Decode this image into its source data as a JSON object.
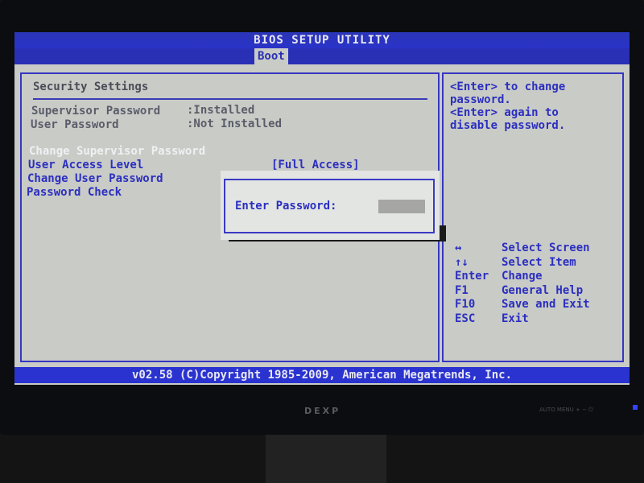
{
  "header": {
    "title": "BIOS SETUP UTILITY",
    "active_tab": "Boot"
  },
  "left_panel": {
    "title": "Security Settings",
    "status": [
      {
        "label": "Supervisor Password",
        "value": ":Installed"
      },
      {
        "label": "User Password",
        "value": ":Not Installed"
      }
    ],
    "items": [
      {
        "label": "Change Supervisor Password",
        "value": ""
      },
      {
        "label": "User Access Level",
        "value": "[Full Access]"
      },
      {
        "label": "Change User Password",
        "value": ""
      },
      {
        "label": "Password Check",
        "value": ""
      }
    ]
  },
  "dialog": {
    "label": "Enter Password:",
    "value": ""
  },
  "help": {
    "lines": [
      "<Enter> to change",
      "password.",
      "<Enter> again to",
      "disable password."
    ],
    "keys": [
      {
        "key": "↔",
        "action": "Select Screen"
      },
      {
        "key": "↑↓",
        "action": "Select Item"
      },
      {
        "key": "Enter",
        "action": "Change"
      },
      {
        "key": "F1",
        "action": "General Help"
      },
      {
        "key": "F10",
        "action": "Save and Exit"
      },
      {
        "key": "ESC",
        "action": "Exit"
      }
    ]
  },
  "footer": {
    "text": "v02.58 (C)Copyright 1985-2009, American Megatrends, Inc."
  },
  "monitor": {
    "brand": "DEXP",
    "buttons": "AUTO  MENU   +    −    ⏻"
  },
  "colors": {
    "bios_blue": "#2a30b6",
    "bios_bg": "#c9cbc6",
    "highlight": "#eef0f2"
  }
}
